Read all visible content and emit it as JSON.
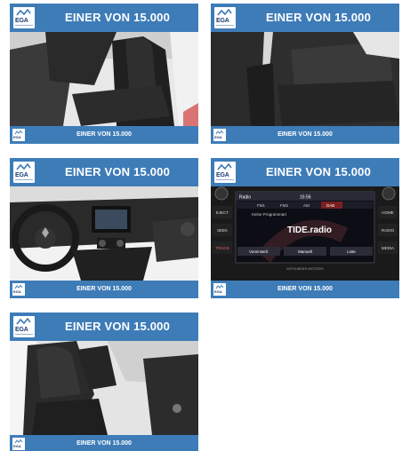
{
  "cards": [
    {
      "title": "EINER VON 15.000",
      "footer": "EINER VON 15.000",
      "logo": "EGA",
      "image": "front-seats-photo"
    },
    {
      "title": "EINER VON 15.000",
      "footer": "EINER VON 15.000",
      "logo": "EGA",
      "image": "rear-seats-photo"
    },
    {
      "title": "EINER VON 15.000",
      "footer": "EINER VON 15.000",
      "logo": "EGA",
      "image": "dashboard-photo"
    },
    {
      "title": "EINER VON 15.000",
      "footer": "EINER VON 15.000",
      "logo": "EGA",
      "image": "radio-display-photo"
    },
    {
      "title": "EINER VON 15.000",
      "footer": "EINER VON 15.000",
      "logo": "EGA",
      "image": "passenger-seat-photo"
    }
  ],
  "radio": {
    "screen_title": "Radio",
    "clock": "15:56",
    "bands": [
      "FM1",
      "FM2",
      "AM",
      "DAB"
    ],
    "message": "Keine Programmart",
    "station": "TIDE.radio",
    "buttons": [
      "Voreinstell.",
      "Manuell",
      "Liste"
    ],
    "side_left": [
      "EJECT",
      "SEEK",
      "TRACK"
    ],
    "side_right": [
      "HOME",
      "RADIO",
      "MEDIA"
    ],
    "brand": "MITSUBISHI MOTORS"
  },
  "colors": {
    "banner": "#3e7cb8",
    "logo_text": "#1b3d73"
  }
}
